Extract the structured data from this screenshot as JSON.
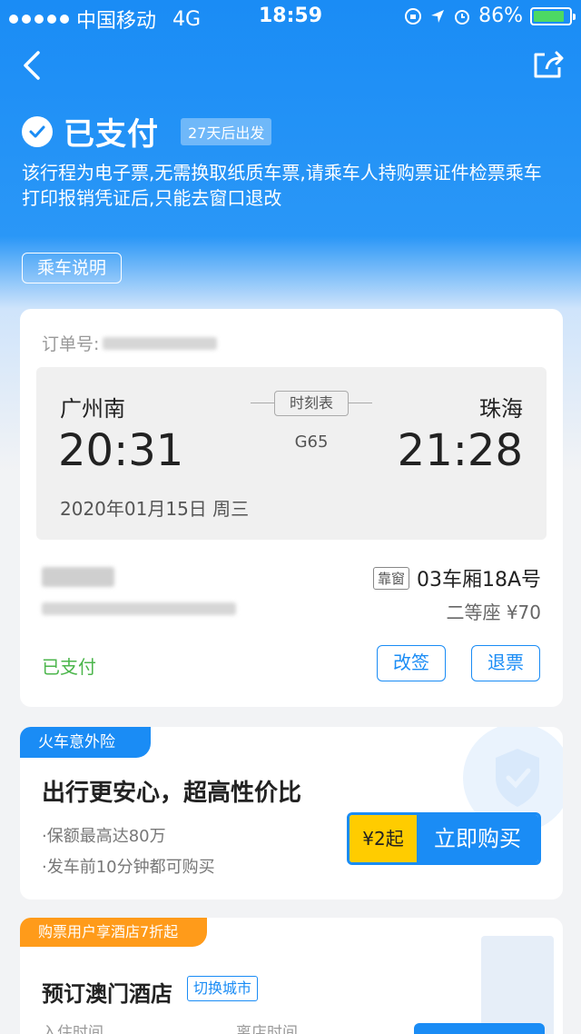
{
  "status_bar": {
    "carrier": "中国移动",
    "network": "4G",
    "time": "18:59",
    "battery": "86%",
    "battery_level": 0.86
  },
  "header": {
    "paid_title": "已支付",
    "depart_badge": "27天后出发",
    "notice_line1": "该行程为电子票,无需换取纸质车票,请乘车人持购票证件检票乘车",
    "notice_line2": "打印报销凭证后,只能去窗口退改",
    "ride_button": "乘车说明"
  },
  "ticket": {
    "order_label": "订单号:",
    "from_station": "广州南",
    "to_station": "珠海",
    "from_time": "20:31",
    "to_time": "21:28",
    "schedule_button": "时刻表",
    "train_no": "G65",
    "date": "2020年01月15日 周三",
    "window_tag": "靠窗",
    "seat_no": "03车厢18A号",
    "seat_class": "二等座 ¥70",
    "status": "已支付",
    "change_button": "改签",
    "refund_button": "退票"
  },
  "insurance": {
    "tag": "火车意外险",
    "title": "出行更安心，超高性价比",
    "point1": "·保额最高达80万",
    "point2": "·发车前10分钟都可购买",
    "price": "¥2起",
    "buy_label": "立即购买"
  },
  "hotel": {
    "tag": "购票用户享酒店7折起",
    "title": "预订澳门酒店",
    "switch_city": "切换城市",
    "checkin_label": "入住时间",
    "checkout_label": "离店时间"
  },
  "colors": {
    "primary": "#1a8cf5",
    "paid_green": "#4cb64c",
    "price_yellow": "#ffcc00",
    "hotel_orange": "#ff9b1a"
  }
}
